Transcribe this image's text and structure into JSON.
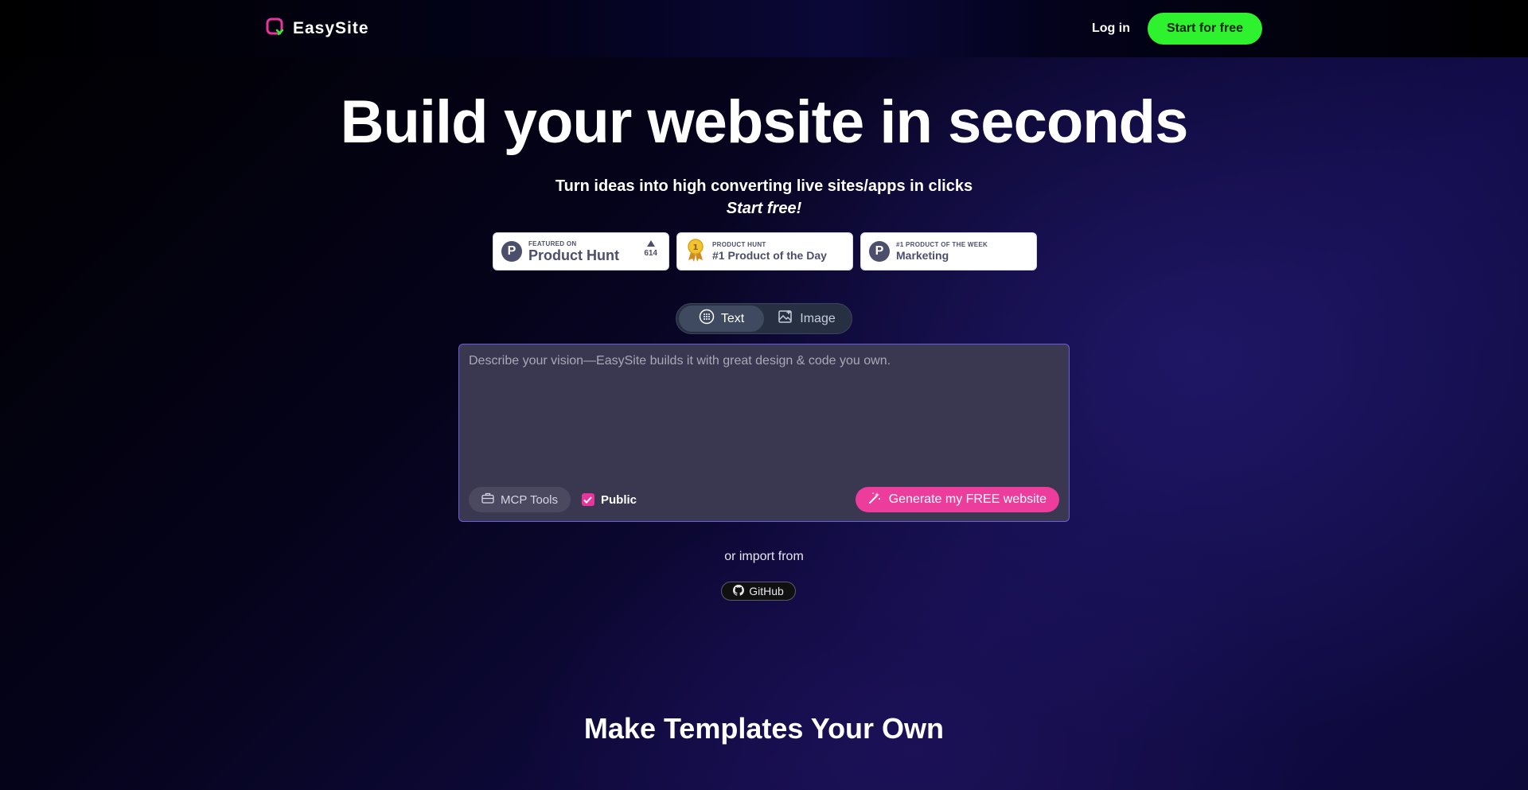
{
  "brand": {
    "name": "EasySite",
    "accent": "#e8359b",
    "leaf": "#2ef22e"
  },
  "nav": {
    "login": "Log in",
    "cta": "Start for free"
  },
  "hero": {
    "headline": "Build your website in seconds",
    "subtitle": "Turn ideas into high converting live sites/apps in clicks",
    "subtitle_em": "Start free!"
  },
  "badges": [
    {
      "small": "FEATURED ON",
      "big": "Product Hunt",
      "votes": "614"
    },
    {
      "small": "PRODUCT HUNT",
      "big": "#1 Product of the Day"
    },
    {
      "small": "#1 PRODUCT OF THE WEEK",
      "big": "Marketing"
    }
  ],
  "mode_toggle": {
    "text": "Text",
    "image": "Image",
    "active": "Text"
  },
  "prompt": {
    "placeholder": "Describe your vision—EasySite builds it with great design & code you own.",
    "mcp_tools": "MCP Tools",
    "public_label": "Public",
    "public_checked": true,
    "generate": "Generate my FREE website"
  },
  "import": {
    "label": "or import from",
    "github": "GitHub"
  },
  "section": {
    "title": "Make Templates Your Own"
  }
}
